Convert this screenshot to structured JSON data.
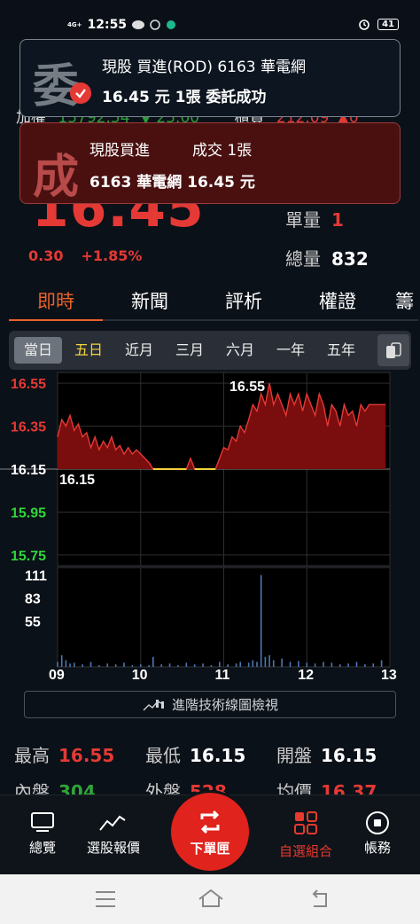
{
  "status_bar": {
    "time": "12:55",
    "network": "4G+",
    "battery": "41"
  },
  "header_row": {
    "index_label": "加權",
    "index_value": "15792.54",
    "index_change": "▼ 25.00",
    "right_label": "櫃買",
    "right_value": "212.09",
    "right_change": "▲0"
  },
  "quote": {
    "price": "16.45",
    "change": "0.30",
    "change_pct": "+1.85%",
    "unit_volume_label": "單量",
    "unit_volume_value": "1",
    "total_volume_label": "總量",
    "total_volume_value": "832"
  },
  "tabs": [
    "即時",
    "新聞",
    "評析",
    "權證",
    "籌"
  ],
  "periods": [
    "當日",
    "五日",
    "近月",
    "三月",
    "六月",
    "一年",
    "五年"
  ],
  "chart_data": {
    "type": "line",
    "price_axis_labels": [
      "16.55",
      "16.35",
      "16.15",
      "15.95",
      "15.75"
    ],
    "price_axis_colors": [
      "#e53935",
      "#e53935",
      "#ffffff",
      "#2fd53a",
      "#2fd53a"
    ],
    "reference_price": 16.15,
    "y_range": [
      15.7,
      16.6
    ],
    "x_labels": [
      "09",
      "10",
      "11",
      "12",
      "13"
    ],
    "x_range": [
      9,
      13
    ],
    "high_label": "16.55",
    "low_label": "16.15",
    "price_series": [
      [
        9.0,
        16.3
      ],
      [
        9.05,
        16.38
      ],
      [
        9.1,
        16.35
      ],
      [
        9.15,
        16.4
      ],
      [
        9.2,
        16.33
      ],
      [
        9.25,
        16.36
      ],
      [
        9.3,
        16.3
      ],
      [
        9.35,
        16.32
      ],
      [
        9.4,
        16.25
      ],
      [
        9.45,
        16.3
      ],
      [
        9.5,
        16.24
      ],
      [
        9.55,
        16.28
      ],
      [
        9.6,
        16.25
      ],
      [
        9.65,
        16.3
      ],
      [
        9.7,
        16.24
      ],
      [
        9.75,
        16.26
      ],
      [
        9.8,
        16.22
      ],
      [
        9.85,
        16.25
      ],
      [
        9.9,
        16.22
      ],
      [
        9.95,
        16.24
      ],
      [
        10.0,
        16.22
      ],
      [
        10.05,
        16.2
      ],
      [
        10.1,
        16.18
      ],
      [
        10.15,
        16.15
      ],
      [
        10.2,
        16.15
      ],
      [
        10.4,
        16.15
      ],
      [
        10.55,
        16.15
      ],
      [
        10.6,
        16.2
      ],
      [
        10.65,
        16.15
      ],
      [
        10.9,
        16.15
      ],
      [
        10.95,
        16.2
      ],
      [
        11.0,
        16.25
      ],
      [
        11.05,
        16.24
      ],
      [
        11.1,
        16.3
      ],
      [
        11.15,
        16.28
      ],
      [
        11.2,
        16.35
      ],
      [
        11.25,
        16.32
      ],
      [
        11.3,
        16.38
      ],
      [
        11.35,
        16.45
      ],
      [
        11.4,
        16.42
      ],
      [
        11.45,
        16.5
      ],
      [
        11.5,
        16.45
      ],
      [
        11.55,
        16.55
      ],
      [
        11.6,
        16.45
      ],
      [
        11.65,
        16.5
      ],
      [
        11.7,
        16.45
      ],
      [
        11.75,
        16.4
      ],
      [
        11.8,
        16.5
      ],
      [
        11.85,
        16.45
      ],
      [
        11.9,
        16.5
      ],
      [
        11.95,
        16.42
      ],
      [
        12.0,
        16.5
      ],
      [
        12.05,
        16.45
      ],
      [
        12.1,
        16.4
      ],
      [
        12.15,
        16.5
      ],
      [
        12.2,
        16.45
      ],
      [
        12.25,
        16.35
      ],
      [
        12.3,
        16.45
      ],
      [
        12.35,
        16.42
      ],
      [
        12.4,
        16.35
      ],
      [
        12.45,
        16.45
      ],
      [
        12.5,
        16.4
      ],
      [
        12.55,
        16.42
      ],
      [
        12.6,
        16.35
      ],
      [
        12.65,
        16.45
      ],
      [
        12.7,
        16.42
      ],
      [
        12.75,
        16.45
      ],
      [
        12.8,
        16.45
      ],
      [
        12.85,
        16.45
      ],
      [
        12.9,
        16.45
      ],
      [
        12.95,
        16.45
      ]
    ],
    "flat_segments": [
      [
        10.15,
        10.55
      ],
      [
        10.65,
        10.9
      ]
    ],
    "volume_axis_labels": [
      "111",
      "83",
      "55"
    ],
    "volume_y_range": [
      0,
      120
    ],
    "volume_series": [
      [
        9.0,
        6
      ],
      [
        9.05,
        14
      ],
      [
        9.1,
        8
      ],
      [
        9.15,
        4
      ],
      [
        9.2,
        5
      ],
      [
        9.3,
        3
      ],
      [
        9.4,
        6
      ],
      [
        9.5,
        2
      ],
      [
        9.6,
        4
      ],
      [
        9.7,
        3
      ],
      [
        9.8,
        5
      ],
      [
        9.9,
        2
      ],
      [
        10.0,
        3
      ],
      [
        10.1,
        2
      ],
      [
        10.15,
        12
      ],
      [
        10.25,
        3
      ],
      [
        10.35,
        4
      ],
      [
        10.45,
        2
      ],
      [
        10.55,
        5
      ],
      [
        10.65,
        3
      ],
      [
        10.75,
        4
      ],
      [
        10.85,
        2
      ],
      [
        10.95,
        6
      ],
      [
        11.05,
        3
      ],
      [
        11.15,
        4
      ],
      [
        11.2,
        6
      ],
      [
        11.3,
        5
      ],
      [
        11.35,
        8
      ],
      [
        11.4,
        6
      ],
      [
        11.45,
        111
      ],
      [
        11.5,
        12
      ],
      [
        11.55,
        14
      ],
      [
        11.6,
        8
      ],
      [
        11.7,
        10
      ],
      [
        11.8,
        6
      ],
      [
        11.9,
        7
      ],
      [
        12.0,
        5
      ],
      [
        12.1,
        4
      ],
      [
        12.2,
        6
      ],
      [
        12.3,
        5
      ],
      [
        12.4,
        3
      ],
      [
        12.5,
        4
      ],
      [
        12.6,
        6
      ],
      [
        12.7,
        3
      ],
      [
        12.8,
        4
      ],
      [
        12.9,
        8
      ]
    ]
  },
  "tech_button": "進階技術線圖檢視",
  "stats": {
    "high_label": "最高",
    "high_value": "16.55",
    "low_label": "最低",
    "low_value": "16.15",
    "open_label": "開盤",
    "open_value": "16.15",
    "inner_label": "內盤",
    "inner_value": "304",
    "outer_label": "外盤",
    "outer_value": "528",
    "avg_label": "均價",
    "avg_value": "16.37"
  },
  "notifications": [
    {
      "badge": "委",
      "line1": "現股 買進(ROD) 6163 華電網",
      "line2": "16.45 元 1張 委託成功"
    },
    {
      "badge": "成",
      "line1a": "現股買進",
      "line1b": "成交 1張",
      "line2": "6163 華電網 16.45 元"
    }
  ],
  "bottom_nav": [
    {
      "label": "總覽",
      "icon": "monitor-icon"
    },
    {
      "label": "選股報價",
      "icon": "trend-icon"
    },
    {
      "label": "下單匣",
      "icon": "swap-icon"
    },
    {
      "label": "自選組合",
      "icon": "grid-icon"
    },
    {
      "label": "帳務",
      "icon": "circle-stop-icon"
    }
  ],
  "colors": {
    "up": "#e53935",
    "down": "#2fd53a",
    "accent": "#e8622b",
    "nav_active": "#e8392f"
  }
}
